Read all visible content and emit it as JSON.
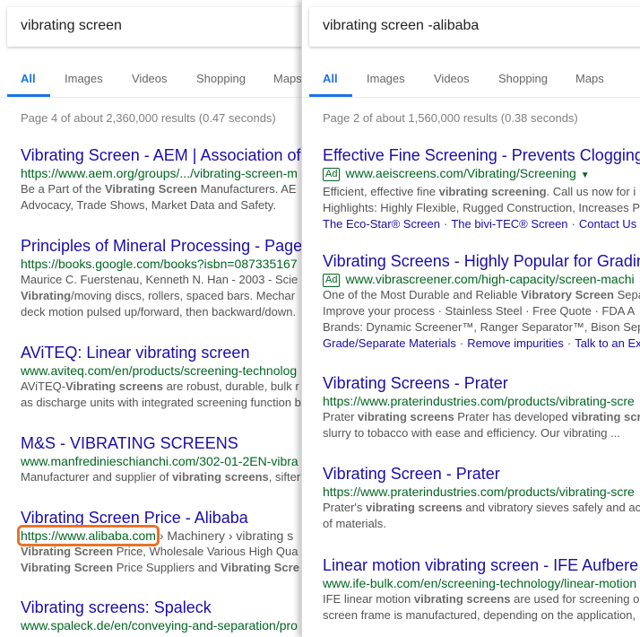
{
  "left": {
    "query": "vibrating screen",
    "tabs": [
      "All",
      "Images",
      "Videos",
      "Shopping",
      "Maps"
    ],
    "stats": "Page 4 of about 2,360,000 results (0.47 seconds)",
    "results": [
      {
        "title": "Vibrating Screen - AEM | Association of",
        "url": "https://www.aem.org/groups/.../vibrating-screen-m",
        "snippet": [
          [
            "Be a Part of the ",
            "Vibrating Screen",
            " Manufacturers. AE"
          ],
          [
            "Advocacy, Trade Shows, Market Data and Safety."
          ]
        ]
      },
      {
        "title": "Principles of Mineral Processing - Page",
        "url": "https://books.google.com/books?isbn=087335167",
        "snippet": [
          [
            "Maurice C. Fuerstenau, Kenneth N. Han - 2003 - Scie"
          ],
          [
            "",
            "Vibrating",
            "/moving discs, rollers, spaced bars. Mechar"
          ],
          [
            "deck motion pulsed up/forward, then backward/down."
          ]
        ]
      },
      {
        "title": "AViTEQ: Linear vibrating screen",
        "url": "www.aviteq.com/en/products/screening-technolog",
        "snippet": [
          [
            "AViTEQ-",
            "Vibrating screens",
            " are robust, durable, bulk r"
          ],
          [
            "as discharge units with integrated screening function b"
          ]
        ]
      },
      {
        "title": "M&S - VIBRATING SCREENS",
        "url": "www.manfredinieschianchi.com/302-01-2EN-vibra",
        "snippet": [
          [
            "Manufacturer and supplier of ",
            "vibrating screens",
            ", sifter"
          ]
        ]
      },
      {
        "title": "Vibrating Screen Price - Alibaba",
        "url": "https://www.alibaba.com",
        "crumb": " › Machinery › vibrating s",
        "snippet": [
          [
            "",
            "Vibrating Screen",
            " Price, Wholesale Various High Qua"
          ],
          [
            "",
            "Vibrating Screen",
            " Price Suppliers and ",
            "Vibrating Scre",
            ""
          ]
        ]
      },
      {
        "title": "Vibrating screens: Spaleck",
        "url": "www.spaleck.de/en/conveying-and-separation/pro",
        "snippet": []
      }
    ]
  },
  "right": {
    "query": "vibrating screen -alibaba",
    "tabs": [
      "All",
      "Images",
      "Videos",
      "Shopping",
      "Maps"
    ],
    "stats": "Page 2 of about 1,560,000 results (0.38 seconds)",
    "ad_label": "Ad",
    "results": [
      {
        "title": "Effective Fine Screening - Prevents Clogging",
        "ad": true,
        "url": "www.aeiscreens.com/Vibrating/Screening",
        "caret": "▼",
        "snippet": [
          [
            "Efficient, effective fine ",
            "vibrating screening",
            ". Call us now for i"
          ],
          [
            "Highlights: Highly Flexible, Rugged Construction, Increases P"
          ]
        ],
        "links": [
          "The Eco-Star® Screen",
          "The bivi-TEC® Screen",
          "Contact Us"
        ]
      },
      {
        "title": "Vibrating Screens - Highly Popular for Gradin",
        "ad": true,
        "url": "www.vibrascreener.com/high-capacity/screen-machi",
        "snippet": [
          [
            "One of the Most Durable and Reliable ",
            "Vibratory Screen",
            " Sepa"
          ],
          [
            "Improve your process · Stainless Steel · Free Quote · FDA A"
          ],
          [
            "Brands: Dynamic Screener™, Ranger Separator™, Bison Sep"
          ]
        ],
        "links": [
          "Grade/Separate Materials",
          "Remove impurities",
          "Talk to an Ex"
        ]
      },
      {
        "title": "Vibrating Screens - Prater",
        "url": "https://www.praterindustries.com/products/vibrating-scre",
        "snippet": [
          [
            "Prater ",
            "vibrating screens",
            " Prater has developed ",
            "vibrating scr",
            ""
          ],
          [
            "slurry to tobacco with ease and efficiency. Our vibrating ..."
          ]
        ]
      },
      {
        "title": "Vibrating Screen - Prater",
        "url": "https://www.praterindustries.com/products/vibrating-scre",
        "snippet": [
          [
            "Prater's ",
            "vibrating screens",
            " and vibratory sieves safely and ac"
          ],
          [
            "of materials."
          ]
        ]
      },
      {
        "title": "Linear motion vibrating screen - IFE Aufbere",
        "url": "www.ife-bulk.com/en/screening-technology/linear-motion",
        "snippet": [
          [
            "IFE linear motion ",
            "vibrating screens",
            " are used for screening o"
          ],
          [
            "screen frame is manufactured, depending on the application,"
          ]
        ]
      }
    ]
  },
  "colors": {
    "accent": "#1a73e8",
    "link": "#1a0dab",
    "url_green": "#006621",
    "snippet_gray": "#545454",
    "highlight_box": "#e8742a"
  }
}
